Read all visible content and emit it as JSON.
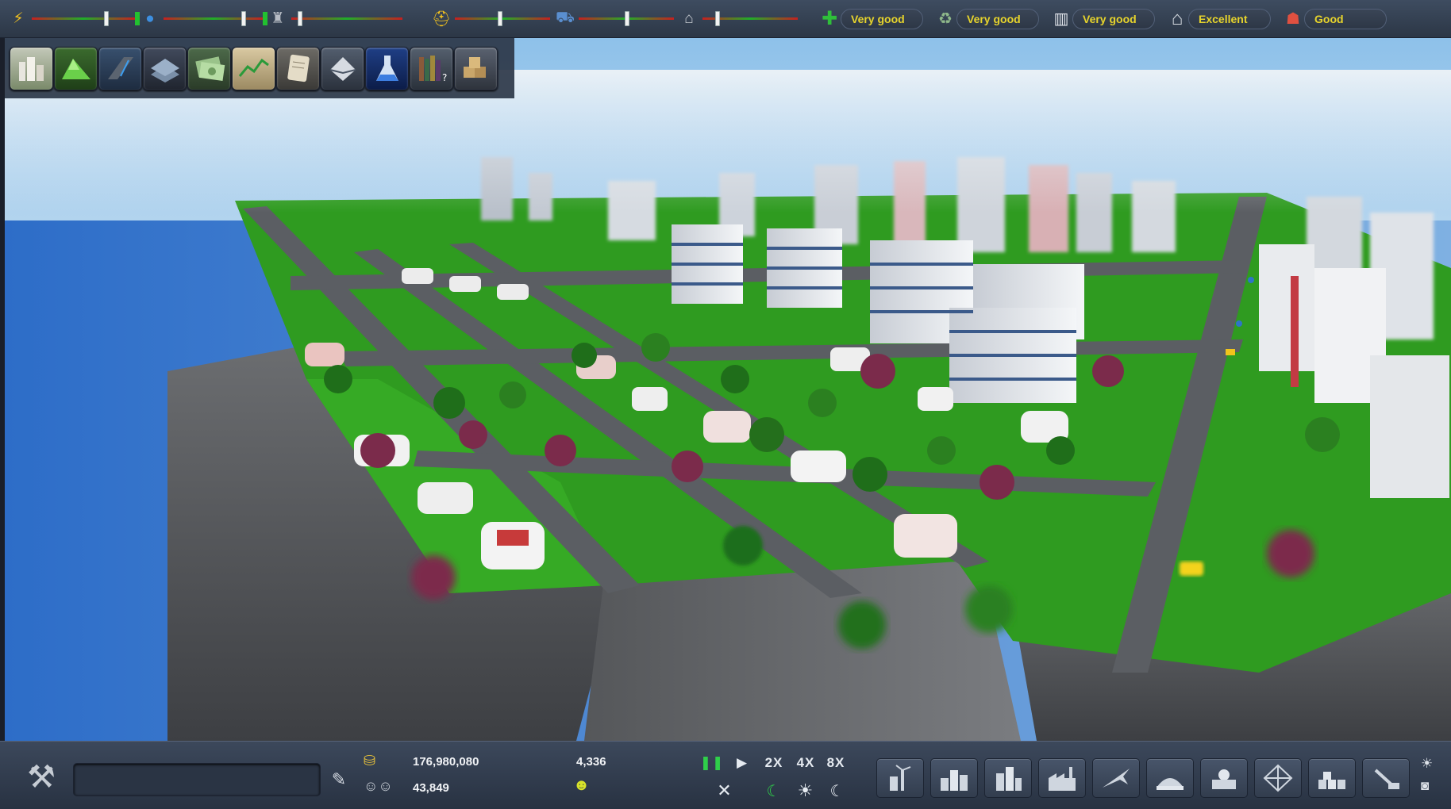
{
  "top_bar": {
    "meters": [
      {
        "name": "electricity",
        "icon": "⚡",
        "color": "#f3c21e",
        "level": 0.73
      },
      {
        "name": "water",
        "icon": "💧",
        "color": "#3d8fe0",
        "level": 0.82
      },
      {
        "name": "waste",
        "icon": "♜",
        "color": "#b7bcc4",
        "level": 0.06
      },
      {
        "name": "police",
        "icon": "⛑",
        "color": "#f3c21e",
        "level": 0.47
      },
      {
        "name": "fire",
        "icon": "🚒",
        "color": "#5a8fd0",
        "level": 0.51
      },
      {
        "name": "education",
        "icon": "🎓",
        "color": "#c8ccd2",
        "level": 0.14
      }
    ],
    "statuses": [
      {
        "name": "health",
        "label": "Very good"
      },
      {
        "name": "environment",
        "label": "Very good"
      },
      {
        "name": "culture",
        "label": "Very good"
      },
      {
        "name": "housing",
        "label": "Excellent"
      },
      {
        "name": "jobs",
        "label": "Good"
      }
    ]
  },
  "categories": [
    {
      "name": "city-overview"
    },
    {
      "name": "terrain"
    },
    {
      "name": "roads"
    },
    {
      "name": "zones"
    },
    {
      "name": "budget"
    },
    {
      "name": "statistics"
    },
    {
      "name": "policies"
    },
    {
      "name": "mail"
    },
    {
      "name": "research"
    },
    {
      "name": "library"
    },
    {
      "name": "resources"
    }
  ],
  "bottom_bar": {
    "money": "176,980,080",
    "population": "43,849",
    "income": "4,336",
    "happiness_icon": "☻",
    "speed_labels": [
      "2X",
      "4X",
      "8X"
    ],
    "build_buttons": [
      {
        "name": "power-plant"
      },
      {
        "name": "residential"
      },
      {
        "name": "commercial"
      },
      {
        "name": "industry"
      },
      {
        "name": "airport"
      },
      {
        "name": "services"
      },
      {
        "name": "government"
      },
      {
        "name": "landmarks"
      },
      {
        "name": "warehouses"
      },
      {
        "name": "demolish"
      }
    ]
  },
  "colors": {
    "status_text": "#e7d42c",
    "grass": "#2e9a1e",
    "road": "#5b5e63",
    "sky": "#bcdcf0",
    "water": "#2f6fc4"
  }
}
